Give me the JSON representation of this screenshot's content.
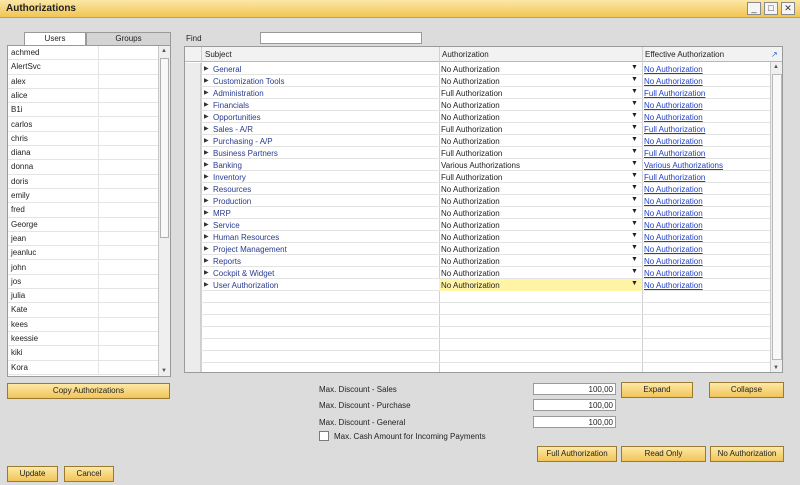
{
  "window": {
    "title": "Authorizations",
    "minimize": "_",
    "maximize": "□",
    "close": "✕"
  },
  "tabs": {
    "users": "Users",
    "groups": "Groups"
  },
  "users": [
    "achmed",
    "AlertSvc",
    "alex",
    "alice",
    "B1i",
    "carlos",
    "chris",
    "diana",
    "donna",
    "doris",
    "emily",
    "fred",
    "George",
    "jean",
    "jeanluc",
    "john",
    "jos",
    "julia",
    "Kate",
    "kees",
    "keessie",
    "kiki",
    "Kora"
  ],
  "find": {
    "label": "Find",
    "value": ""
  },
  "grid": {
    "columns": {
      "subject": "Subject",
      "authorization": "Authorization",
      "effective": "Effective Authorization"
    },
    "rows": [
      {
        "subject": "General",
        "authorization": "No Authorization",
        "effective": "No Authorization"
      },
      {
        "subject": "Customization Tools",
        "authorization": "No Authorization",
        "effective": "No Authorization"
      },
      {
        "subject": "Administration",
        "authorization": "Full Authorization",
        "effective": "Full Authorization"
      },
      {
        "subject": "Financials",
        "authorization": "No Authorization",
        "effective": "No Authorization"
      },
      {
        "subject": "Opportunities",
        "authorization": "No Authorization",
        "effective": "No Authorization"
      },
      {
        "subject": "Sales - A/R",
        "authorization": "Full Authorization",
        "effective": "Full Authorization"
      },
      {
        "subject": "Purchasing - A/P",
        "authorization": "No Authorization",
        "effective": "No Authorization"
      },
      {
        "subject": "Business Partners",
        "authorization": "Full Authorization",
        "effective": "Full Authorization"
      },
      {
        "subject": "Banking",
        "authorization": "Various Authorizations",
        "effective": "Various Authorizations"
      },
      {
        "subject": "Inventory",
        "authorization": "Full Authorization",
        "effective": "Full Authorization"
      },
      {
        "subject": "Resources",
        "authorization": "No Authorization",
        "effective": "No Authorization"
      },
      {
        "subject": "Production",
        "authorization": "No Authorization",
        "effective": "No Authorization"
      },
      {
        "subject": "MRP",
        "authorization": "No Authorization",
        "effective": "No Authorization"
      },
      {
        "subject": "Service",
        "authorization": "No Authorization",
        "effective": "No Authorization"
      },
      {
        "subject": "Human Resources",
        "authorization": "No Authorization",
        "effective": "No Authorization"
      },
      {
        "subject": "Project Management",
        "authorization": "No Authorization",
        "effective": "No Authorization"
      },
      {
        "subject": "Reports",
        "authorization": "No Authorization",
        "effective": "No Authorization"
      },
      {
        "subject": "Cockpit & Widget",
        "authorization": "No Authorization",
        "effective": "No Authorization"
      },
      {
        "subject": "User Authorization",
        "authorization": "No Authorization",
        "effective": "No Authorization"
      }
    ],
    "selected_row": 18
  },
  "buttons": {
    "copy": "Copy Authorizations",
    "expand": "Expand",
    "collapse": "Collapse",
    "full": "Full Authorization",
    "readonly": "Read Only",
    "none": "No Authorization",
    "update": "Update",
    "cancel": "Cancel"
  },
  "discounts": {
    "sales_label": "Max. Discount - Sales",
    "sales_value": "100,00",
    "purchase_label": "Max. Discount - Purchase",
    "purchase_value": "100,00",
    "general_label": "Max. Discount - General",
    "general_value": "100,00"
  },
  "cash": {
    "label": "Max. Cash Amount for Incoming Payments",
    "checked": false
  },
  "colors": {
    "title_bar": "#f2c553",
    "button": "#f1c45a",
    "link": "#1f3fc4",
    "selected": "#fff3a6"
  }
}
